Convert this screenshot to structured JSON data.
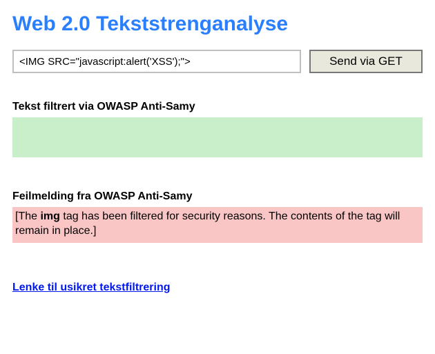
{
  "heading": "Web 2.0 Tekststrenganalyse",
  "form": {
    "input_value": "<IMG SRC=\"javascript:alert('XSS');\">",
    "submit_label": "Send via GET"
  },
  "filtered": {
    "label": "Tekst filtrert via OWASP Anti-Samy",
    "content": ""
  },
  "error": {
    "label": "Feilmelding fra OWASP Anti-Samy",
    "prefix": "[The ",
    "bold_tag": "img",
    "suffix": " tag has been filtered for security reasons. The contents of the tag will remain in place.]"
  },
  "link": {
    "text": "Lenke til usikret tekstfiltrering"
  }
}
